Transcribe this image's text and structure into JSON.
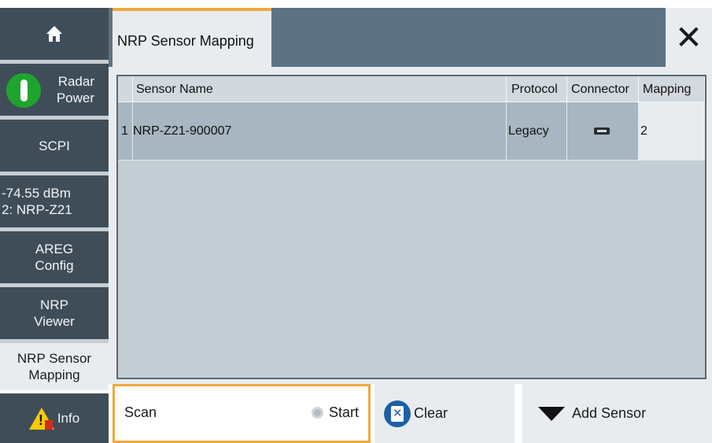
{
  "window": {
    "active_tab": "NRP Sensor Mapping",
    "close_symbol": "✕"
  },
  "sidebar": {
    "items": [
      {
        "label": "",
        "icon": "home-icon"
      },
      {
        "label_line1": "Radar",
        "label_line2": "Power",
        "indicator": "power-on",
        "indicator_color": "#1fa52e"
      },
      {
        "label": "SCPI"
      },
      {
        "label_line1": "-74.55 dBm",
        "label_line2": "2: NRP-Z21"
      },
      {
        "label_line1": "AREG",
        "label_line2": "Config"
      },
      {
        "label_line1": "NRP",
        "label_line2": "Viewer"
      },
      {
        "label_line1": "NRP Sensor",
        "label_line2": "Mapping",
        "active": true
      },
      {
        "label": "Info",
        "icon": "warning-icon"
      }
    ]
  },
  "table": {
    "columns": [
      "Sensor Name",
      "Protocol",
      "Connector",
      "Mapping"
    ],
    "rows": [
      {
        "index": "1",
        "sensor_name": "NRP-Z21-900007",
        "protocol": "Legacy",
        "connector_icon": "usb-connector-icon",
        "mapping": "2"
      }
    ]
  },
  "bottom": {
    "scan_label": "Scan",
    "start_label": "Start",
    "clear_label": "Clear",
    "add_sensor_label": "Add Sensor"
  },
  "colors": {
    "accent": "#f0a83c",
    "sidebar_bg": "#3f4d58",
    "title_bar": "#5e7282",
    "panel_bg": "#e9ecee",
    "status_green": "#1fa52e",
    "clear_blue": "#1d5fa6"
  }
}
